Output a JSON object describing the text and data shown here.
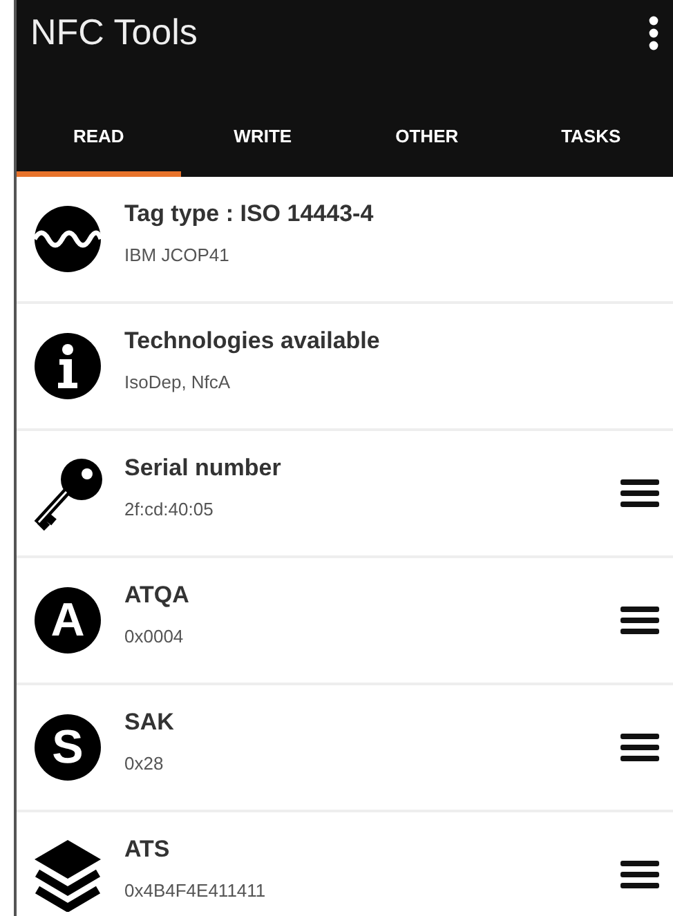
{
  "app_bar": {
    "title": "NFC Tools"
  },
  "tabs": [
    {
      "label": "READ",
      "selected": true
    },
    {
      "label": "WRITE",
      "selected": false
    },
    {
      "label": "OTHER",
      "selected": false
    },
    {
      "label": "TASKS",
      "selected": false
    }
  ],
  "rows": [
    {
      "kind": "wave",
      "title": "Tag type : ISO 14443-4",
      "value": "IBM JCOP41",
      "menu": false
    },
    {
      "kind": "info",
      "title": "Technologies available",
      "value": "IsoDep, NfcA",
      "menu": false
    },
    {
      "kind": "key",
      "title": "Serial number",
      "value": "2f:cd:40:05",
      "menu": true
    },
    {
      "kind": "letter",
      "letter": "A",
      "title": "ATQA",
      "value": "0x0004",
      "menu": true
    },
    {
      "kind": "letter",
      "letter": "S",
      "title": "SAK",
      "value": "0x28",
      "menu": true
    },
    {
      "kind": "layers",
      "title": "ATS",
      "value": "0x4B4F4E411411",
      "menu": true
    }
  ]
}
